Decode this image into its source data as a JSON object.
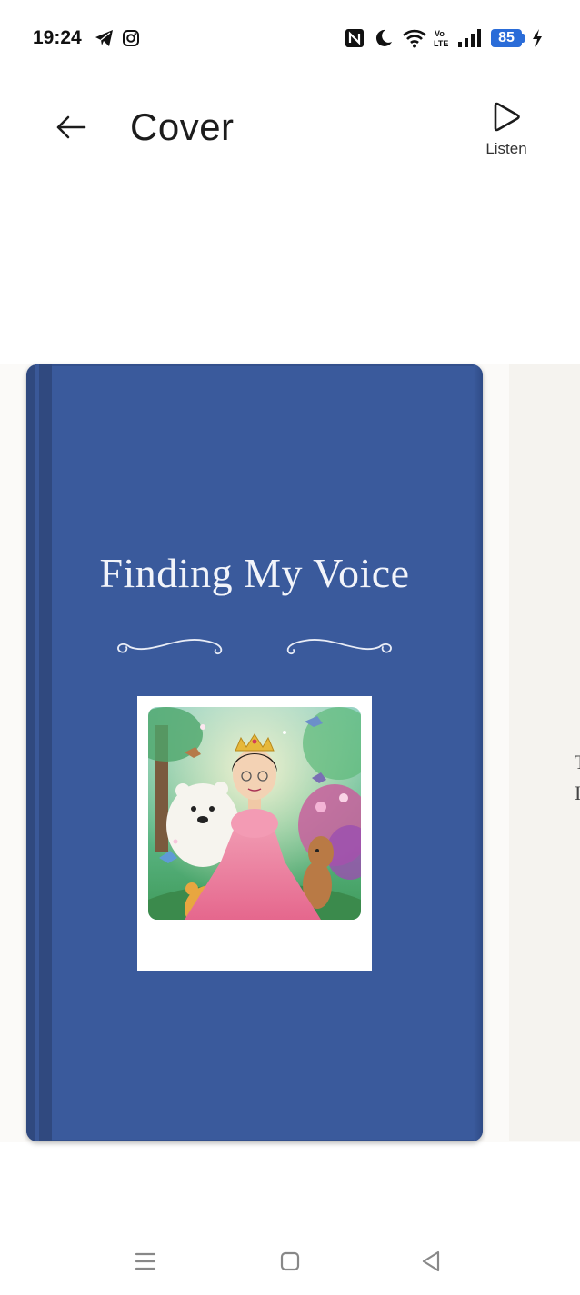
{
  "status_bar": {
    "time": "19:24",
    "battery": "85",
    "icons": [
      "telegram-icon",
      "instagram-icon",
      "nfc-icon",
      "moon-icon",
      "wifi-icon",
      "volte-icon",
      "signal-icon",
      "charging-icon"
    ]
  },
  "header": {
    "title": "Cover",
    "listen_label": "Listen",
    "back_icon": "arrow-left-icon",
    "listen_icon": "play-icon"
  },
  "book": {
    "title": "Finding My Voice",
    "cover_color": "#3a5a9c",
    "photo_description": "cartoon-princess-illustration"
  },
  "next_page": {
    "fragments": [
      "T",
      "I"
    ]
  },
  "nav_bar": {
    "icons": [
      "menu-icon",
      "home-icon",
      "back-triangle-icon"
    ]
  }
}
